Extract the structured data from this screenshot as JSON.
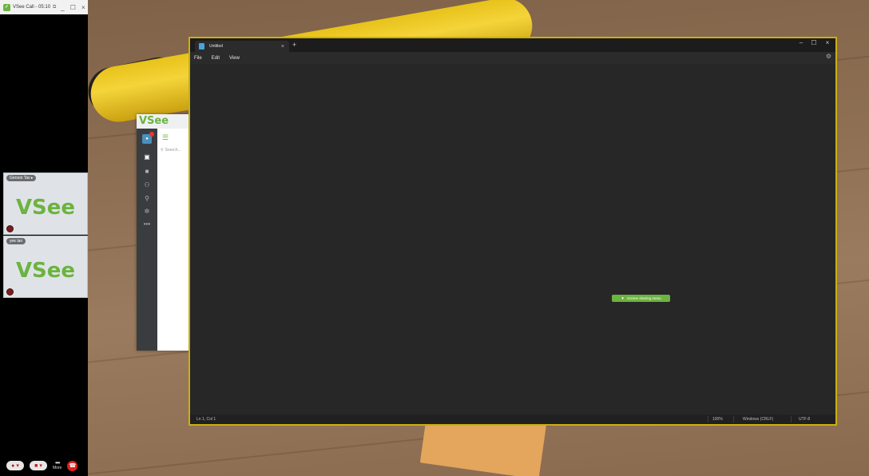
{
  "call_window": {
    "title": "VSee Call - 05:10",
    "controls": {
      "minimize": "_",
      "maximize": "☐",
      "close": "×"
    },
    "participants": [
      {
        "name": "Gerson Tav",
        "logo": "VSee"
      },
      {
        "name": "yee lan",
        "logo": "VSee"
      }
    ],
    "more_label": "More"
  },
  "vsee_app": {
    "brand": "VSee",
    "search_placeholder": "Search..."
  },
  "notepad": {
    "tab_title": "Untitled",
    "menu": [
      "File",
      "Edit",
      "View"
    ],
    "window_controls": {
      "minimize": "–",
      "maximize": "☐",
      "close": "×"
    },
    "share_menu_label": "Screen sharing menu",
    "status": {
      "position": "Ln 1, Col 1",
      "zoom": "100%",
      "line_ending": "Windows (CRLF)",
      "encoding": "UTF-8"
    }
  },
  "colors": {
    "accent": "#6cb33f",
    "focus_border": "#c9b00f",
    "hangup": "#e02020"
  },
  "icons": [
    "vsee-app-icon",
    "restore-icon",
    "mic-muted-icon",
    "camera-off-icon",
    "more-icon",
    "hangup-icon",
    "chat-icon",
    "video-icon",
    "contacts-icon",
    "add-contact-icon",
    "settings-icon",
    "menu-icon",
    "search-icon",
    "notepad-icon",
    "gear-icon",
    "chevron-down-icon"
  ]
}
